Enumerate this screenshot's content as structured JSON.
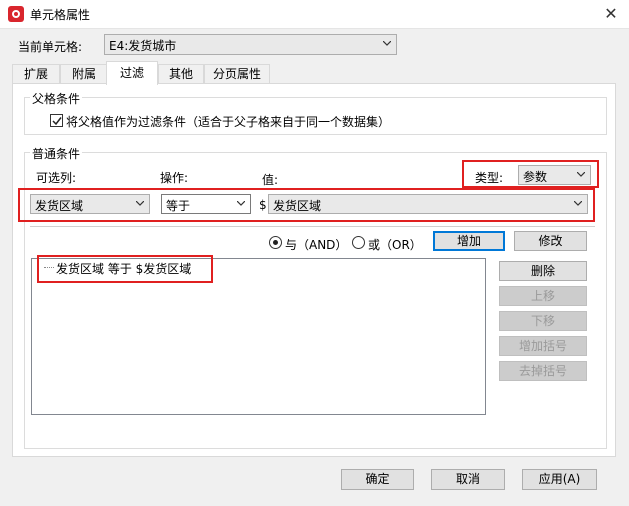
{
  "window": {
    "title": "单元格属性",
    "close_glyph": "✕"
  },
  "current_cell": {
    "label": "当前单元格:",
    "value": "E4:发货城市"
  },
  "tabs": [
    {
      "label": "扩展"
    },
    {
      "label": "附属"
    },
    {
      "label": "过滤",
      "active": true
    },
    {
      "label": "其他"
    },
    {
      "label": "分页属性"
    }
  ],
  "parent_condition": {
    "group_label": "父格条件",
    "checkbox_checked": true,
    "checkbox_label": "将父格值作为过滤条件（适合于父子格来自于同一个数据集）"
  },
  "normal_condition": {
    "group_label": "普通条件",
    "column_label": "可选列:",
    "operation_label": "操作:",
    "value_label": "值:",
    "type_label": "类型:",
    "type_value": "参数",
    "column_value": "发货区域",
    "operation_value": "等于",
    "value_prefix": "$",
    "value_value": "发货区域"
  },
  "logic": {
    "and_label": "与（AND）",
    "or_label": "或（OR）",
    "selected": "and"
  },
  "buttons": {
    "add": "增加",
    "modify": "修改",
    "delete": "删除",
    "move_up": "上移",
    "move_down": "下移",
    "add_bracket": "增加括号",
    "remove_bracket": "去掉括号",
    "ok": "确定",
    "cancel": "取消",
    "apply": "应用(A)"
  },
  "conditions_list": [
    {
      "text": "发货区域 等于 $发货区域"
    }
  ],
  "colors": {
    "highlight_border": "#e02020",
    "default_button_border": "#0078d7"
  }
}
